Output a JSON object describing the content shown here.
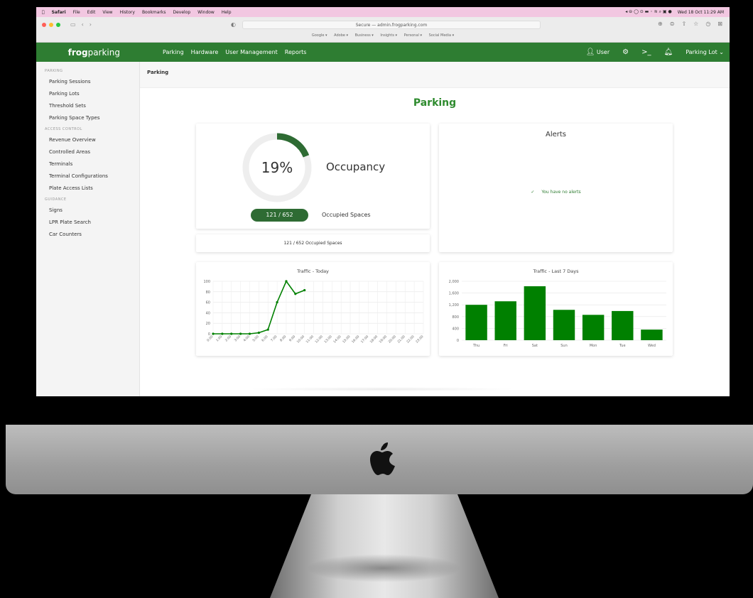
{
  "menubar": {
    "items": [
      "Safari",
      "File",
      "Edit",
      "View",
      "History",
      "Bookmarks",
      "Develop",
      "Window",
      "Help"
    ],
    "clock": "Wed 18 Oct  11:29 AM"
  },
  "browser": {
    "address": "Secure — admin.frogparking.com",
    "bookmarks": [
      "Google ▾",
      "Adobe ▾",
      "Business ▾",
      "Insights ▾",
      "Personal ▾",
      "Social Media ▾"
    ]
  },
  "appnav": {
    "brand_bold": "frog",
    "brand_light": "parking",
    "links": [
      "Parking",
      "Hardware",
      "User Management",
      "Reports"
    ],
    "user": "User",
    "lot_selector": "Parking Lot"
  },
  "sidebar": {
    "sections": [
      {
        "heading": "PARKING",
        "items": [
          "Parking Sessions",
          "Parking Lots",
          "Threshold Sets",
          "Parking Space Types"
        ]
      },
      {
        "heading": "ACCESS CONTROL",
        "items": [
          "Revenue Overview",
          "Controlled Areas",
          "Terminals",
          "Terminal Configurations",
          "Plate Access Lists"
        ]
      },
      {
        "heading": "GUIDANCE",
        "items": [
          "Signs",
          "LPR Plate Search",
          "Car Counters"
        ]
      }
    ]
  },
  "breadcrumb": "Parking",
  "page": {
    "title": "Parking",
    "occupancy": {
      "percent_label": "19%",
      "percent": 19,
      "label": "Occupancy",
      "badge": "121 / 652",
      "badge_label": "Occupied Spaces",
      "summary": "121 / 652  Occupied Spaces"
    },
    "alerts": {
      "title": "Alerts",
      "message": "You have no alerts"
    }
  },
  "colors": {
    "brand_green": "#2e7d32",
    "chart_green": "#008000",
    "menubar": "#f2c7e1"
  },
  "chart_data": [
    {
      "type": "line",
      "title": "Traffic - Today",
      "x": [
        "0:00",
        "1:00",
        "2:00",
        "3:00",
        "4:00",
        "5:00",
        "6:00",
        "7:00",
        "8:00",
        "9:00",
        "10:00",
        "11:00",
        "12:00",
        "13:00",
        "14:00",
        "15:00",
        "16:00",
        "17:00",
        "18:00",
        "19:00",
        "20:00",
        "21:00",
        "22:00",
        "23:00"
      ],
      "series": [
        {
          "values": [
            0,
            0,
            0,
            0,
            0,
            2,
            8,
            60,
            100,
            76,
            83
          ]
        }
      ],
      "ylim": [
        0,
        100
      ],
      "yticks": [
        0,
        20,
        40,
        60,
        80,
        100
      ],
      "grid": true
    },
    {
      "type": "bar",
      "title": "Traffic - Last 7 Days",
      "categories": [
        "Thu",
        "Fri",
        "Sat",
        "Sun",
        "Mon",
        "Tue",
        "Wed"
      ],
      "values": [
        1200,
        1320,
        1830,
        1030,
        860,
        990,
        360
      ],
      "ylim": [
        0,
        2000
      ],
      "yticks": [
        0,
        400,
        800,
        1200,
        1600,
        2000
      ],
      "ytick_labels": [
        "0",
        "400",
        "800",
        "1,200",
        "1,600",
        "2,000"
      ],
      "grid": true
    }
  ]
}
